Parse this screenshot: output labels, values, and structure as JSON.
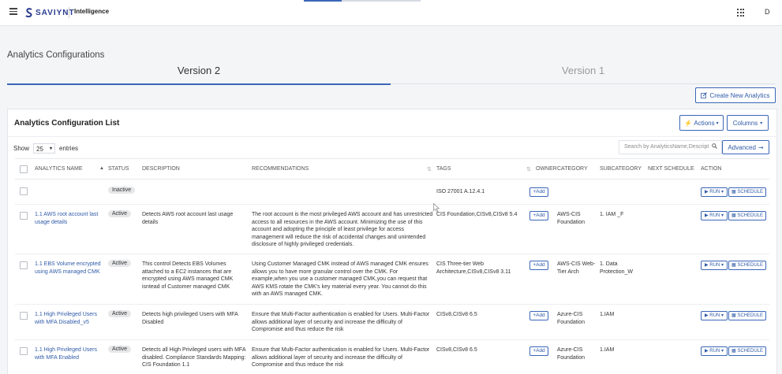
{
  "topbar": {
    "brand": "SAVIYNT",
    "product": "Intelligence",
    "user_initial": "D"
  },
  "page": {
    "title": "Analytics Configurations",
    "tabs": [
      {
        "label": "Version 2",
        "active": true
      },
      {
        "label": "Version 1",
        "active": false
      }
    ],
    "create_button": "Create New Analytics"
  },
  "card": {
    "title": "Analytics Configuration List",
    "actions_label": "Actions",
    "columns_label": "Columns",
    "show_prefix": "Show",
    "entries_value": "25",
    "show_suffix": "entries",
    "search_placeholder": "Search by AnalyticsName,Descript",
    "advanced_label": "Advanced"
  },
  "table": {
    "headers": {
      "name": "ANALYTICS NAME",
      "status": "STATUS",
      "description": "DESCRIPTION",
      "recommendations": "RECOMMENDATIONS",
      "tags": "TAGS",
      "owner": "OWNER",
      "category": "CATEGORY",
      "subcategory": "SUBCATEGORY",
      "next_schedule": "NEXT SCHEDULE",
      "action": "ACTION"
    },
    "add_label": "+Add",
    "run_label": "RUN",
    "schedule_label": "SCHEDULE",
    "rows": [
      {
        "name": "",
        "status": "Inactive",
        "description": "",
        "recommendations": "",
        "tags": "ISO 27001 A.12.4.1",
        "category": "",
        "subcategory": ""
      },
      {
        "name": "1.1 AWS root account last usage details",
        "status": "Active",
        "description": "Detects AWS root account last usage details",
        "recommendations": "The root account is the most privileged AWS account and has unrestricted access to all resources in the AWS account. Minimizing the use of this account and adopting the principle of least privilege for access management will reduce the risk of accidental changes and unintended disclosure of highly privileged credentials.",
        "tags": "CIS Foundation,CISv8,CISv8 5.4",
        "category": "AWS-CIS Foundation",
        "subcategory": "1. IAM _F"
      },
      {
        "name": "1.1 EBS Volume encrypted using AWS managed CMK",
        "status": "Active",
        "description": "This control Detects EBS Volumes attached to a EC2 instances that are encrypted using AWS managed CMK isntead of Customer managed CMK",
        "recommendations": "Using Customer Managed CMK instead of AWS managed CMK ensures allows you to have more granular control over the CMK. For example,when you use a customer managed CMK,you can request that AWS KMS rotate the CMK's key material every year. You cannot do this with an AWS managed CMK.",
        "tags": "CIS Three-tier Web Architecture,CISv8,CISv8 3.11",
        "category": "AWS-CIS Web-Tier Arch",
        "subcategory": "1. Data Protection_W"
      },
      {
        "name": "1.1 High Privileged Users with MFA Disabled_v5",
        "status": "Active",
        "description": "Detects high privileged Users with MFA Disabled",
        "recommendations": "Ensure that Multi-Factor authentication is enabled for Users. Multi-Factor allows additional layer of security and increase the difficulty of Compromise and thus reduce the risk",
        "tags": "CISv8,CISv8 6.5",
        "category": "Azure-CIS Foundation",
        "subcategory": "1.IAM"
      },
      {
        "name": "1.1 High Privileged Users with MFA Enabled",
        "status": "Active",
        "description": "Detects all High Privileged users with MFA disabled. Compliance Standards Mapping: CIS Foundation 1.1",
        "recommendations": "Ensure that Multi-Factor authentication is enabled for Users. Multi-Factor allows additional layer of security and increase the difficulty of Compromise and thus reduce the risk",
        "tags": "CISv8,CISv8 6.5",
        "category": "Azure-CIS Foundation",
        "subcategory": "1.IAM"
      }
    ]
  }
}
